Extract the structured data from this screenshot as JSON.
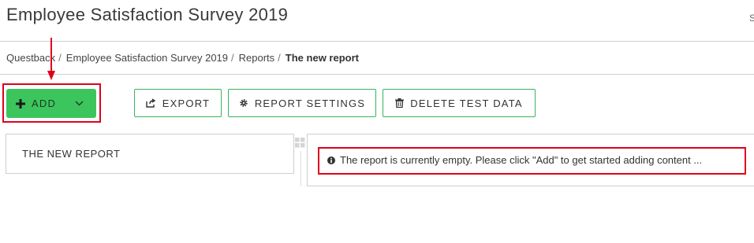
{
  "header": {
    "title": "Employee Satisfaction Survey 2019",
    "corner_text": "S"
  },
  "breadcrumb": {
    "items": [
      "Questback",
      "Employee Satisfaction Survey 2019",
      "Reports"
    ],
    "separator": "/",
    "current": "The new report"
  },
  "toolbar": {
    "add_label": "ADD",
    "export_label": "EXPORT",
    "report_settings_label": "REPORT SETTINGS",
    "delete_test_data_label": "DELETE TEST DATA"
  },
  "reports_list": {
    "items": [
      {
        "label": "THE NEW REPORT"
      }
    ]
  },
  "content": {
    "empty_message": "The report is currently empty. Please click \"Add\" to get started adding content ..."
  },
  "colors": {
    "accent_green": "#3cc55d",
    "border_green": "#36b55a",
    "annotation_red": "#e0001b"
  },
  "icons": [
    "plus-icon",
    "chevron-down-icon",
    "export-icon",
    "gear-icon",
    "trash-icon",
    "drag-handle-icon",
    "info-icon",
    "annotation-arrow-icon"
  ]
}
